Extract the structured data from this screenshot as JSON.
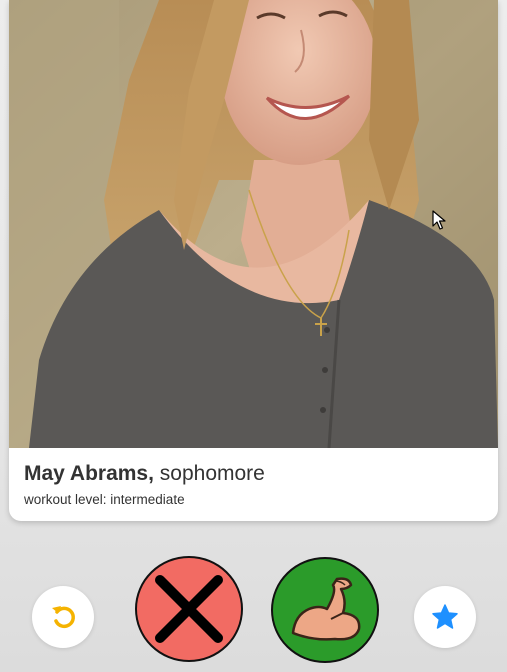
{
  "profile": {
    "name": "May Abrams",
    "separator": ",",
    "year": "sophomore",
    "workout_level": "workout level: intermediate"
  },
  "actions": {
    "undo": {
      "icon": "undo-icon",
      "color": "#f5b301"
    },
    "nope": {
      "icon": "x-icon",
      "color": "#f26b63"
    },
    "like": {
      "icon": "flexed-bicep-icon",
      "color": "#2b9b2a"
    },
    "super_like": {
      "icon": "star-icon",
      "color": "#1e90ff"
    }
  },
  "colors": {
    "background": "#e9e9e9",
    "card": "#ffffff",
    "text": "#333333"
  }
}
